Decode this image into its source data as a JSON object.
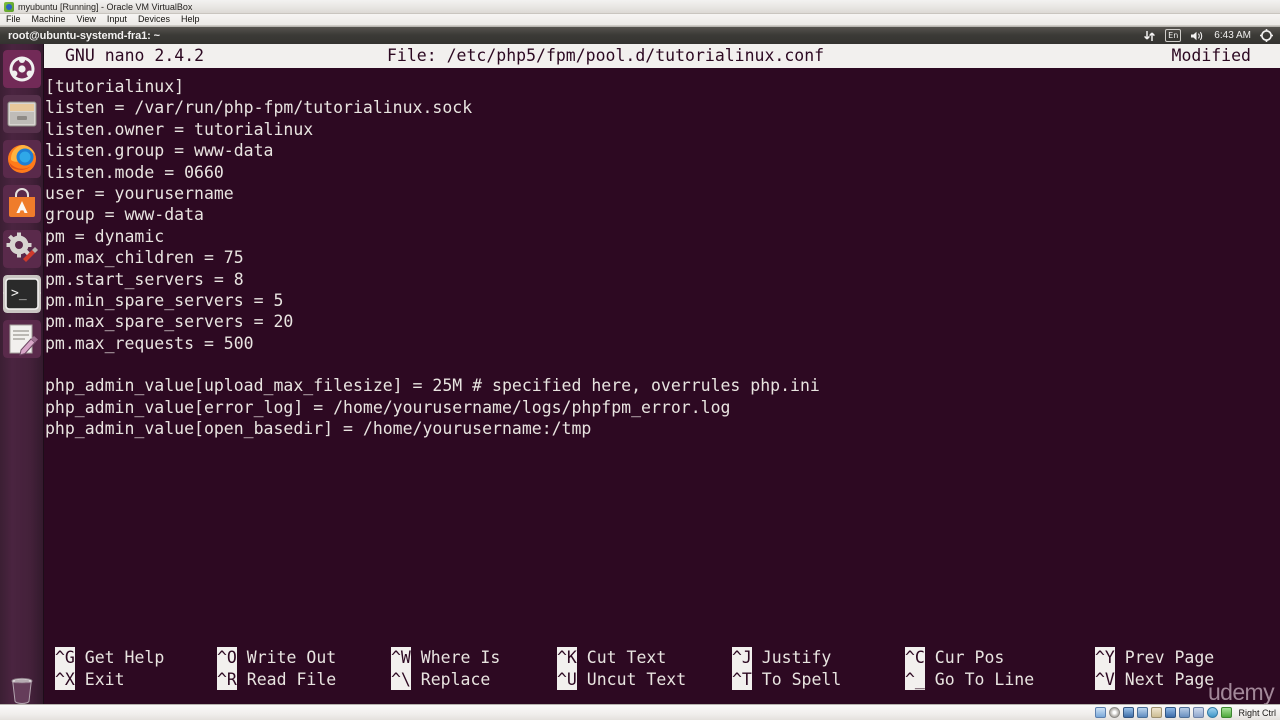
{
  "vbox": {
    "title": "myubuntu [Running] - Oracle VM VirtualBox",
    "menu": [
      "File",
      "Machine",
      "View",
      "Input",
      "Devices",
      "Help"
    ],
    "status_text": "Right Ctrl",
    "status_icons": [
      "hard-disk-icon",
      "optical-disk-icon",
      "network-icon",
      "usb-icon",
      "shared-folder-icon",
      "display-icon",
      "video-capture-icon",
      "remote-desktop-icon",
      "mouse-icon",
      "keyboard-icon"
    ]
  },
  "panel": {
    "window_title": "root@ubuntu-systemd-fra1: ~",
    "network_icon": "network-arrows-icon",
    "keyboard_layout": "En",
    "volume_icon": "volume-icon",
    "clock": "6:43 AM",
    "session_icon": "gear-icon"
  },
  "launcher": {
    "items": [
      {
        "name": "ubuntu-dash",
        "label": "Dash Home",
        "active": false
      },
      {
        "name": "files",
        "label": "Files",
        "active": false
      },
      {
        "name": "firefox",
        "label": "Firefox Web Browser",
        "active": false
      },
      {
        "name": "software-center",
        "label": "Ubuntu Software Center",
        "active": false
      },
      {
        "name": "system-settings",
        "label": "System Settings",
        "active": false
      },
      {
        "name": "terminal",
        "label": "Terminal",
        "active": true
      },
      {
        "name": "text-editor",
        "label": "Text Editor",
        "active": false
      }
    ],
    "trash_label": "Trash"
  },
  "nano": {
    "version": "GNU nano 2.4.2",
    "file_label": "File: /etc/php5/fpm/pool.d/tutorialinux.conf",
    "modified": "Modified",
    "lines": [
      "[tutorialinux]",
      "listen = /var/run/php-fpm/tutorialinux.sock",
      "listen.owner = tutorialinux",
      "listen.group = www-data",
      "listen.mode = 0660",
      "user = yourusername",
      "group = www-data",
      "pm = dynamic",
      "pm.max_children = 75",
      "pm.start_servers = 8",
      "pm.min_spare_servers = 5",
      "pm.max_spare_servers = 20",
      "pm.max_requests = 500",
      "",
      "php_admin_value[upload_max_filesize] = 25M # specified here, overrules php.ini",
      "php_admin_value[error_log] = /home/yourusername/logs/phpfpm_error.log",
      "php_admin_value[open_basedir] = /home/yourusername:/tmp"
    ],
    "cursor": {
      "line_index": 15,
      "column_index": 75,
      "char": "g"
    },
    "shortcuts": [
      [
        {
          "key": "^G",
          "desc": "Get Help"
        },
        {
          "key": "^X",
          "desc": "Exit"
        }
      ],
      [
        {
          "key": "^O",
          "desc": "Write Out"
        },
        {
          "key": "^R",
          "desc": "Read File"
        }
      ],
      [
        {
          "key": "^W",
          "desc": "Where Is"
        },
        {
          "key": "^\\",
          "desc": "Replace"
        }
      ],
      [
        {
          "key": "^K",
          "desc": "Cut Text"
        },
        {
          "key": "^U",
          "desc": "Uncut Text"
        }
      ],
      [
        {
          "key": "^J",
          "desc": "Justify"
        },
        {
          "key": "^T",
          "desc": "To Spell"
        }
      ],
      [
        {
          "key": "^C",
          "desc": "Cur Pos"
        },
        {
          "key": "^_",
          "desc": "Go To Line"
        }
      ],
      [
        {
          "key": "^Y",
          "desc": "Prev Page"
        },
        {
          "key": "^V",
          "desc": "Next Page"
        }
      ]
    ]
  },
  "watermark": {
    "text": "udemy"
  },
  "colors": {
    "terminal_bg": "#2d0922",
    "terminal_fg": "#e8e4e0",
    "nano_bar_bg": "#f2f0ee",
    "launcher_bg": "#44213a",
    "panel_bg": "#3c3b37"
  }
}
